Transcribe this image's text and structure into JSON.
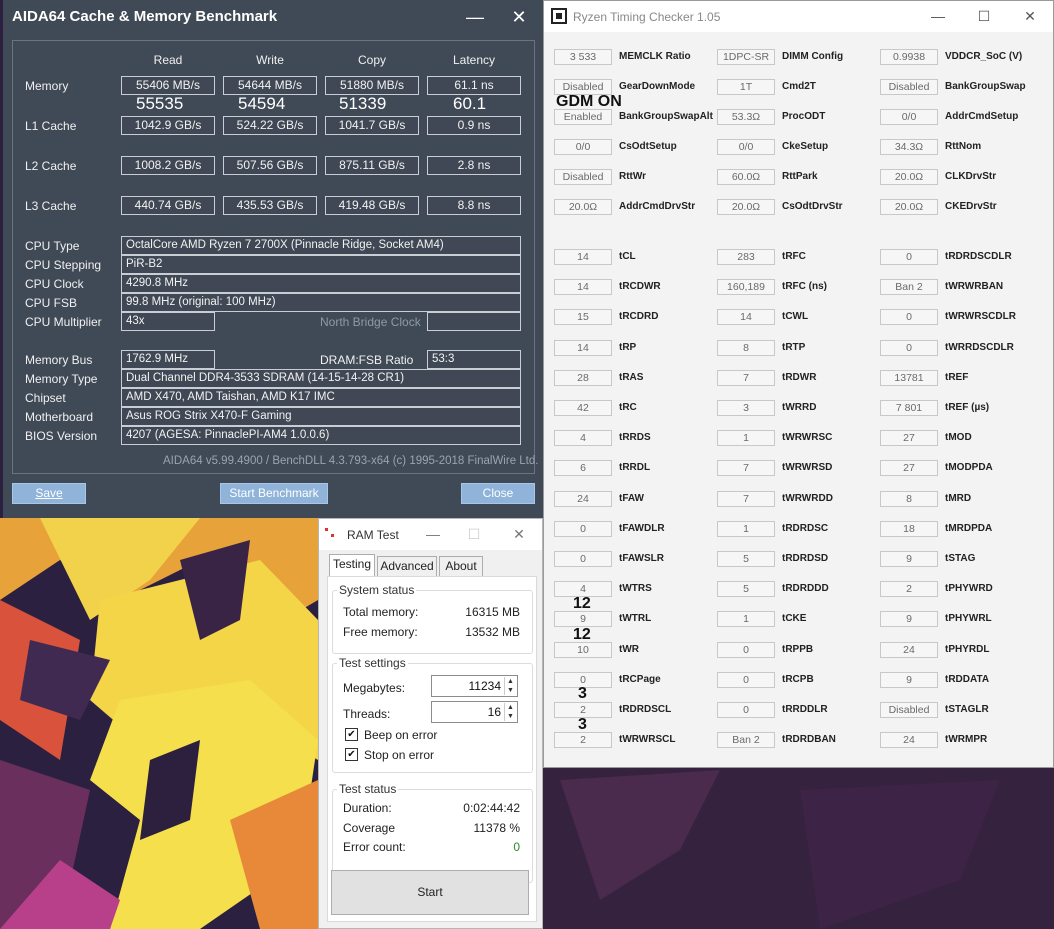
{
  "aida": {
    "title": "AIDA64 Cache & Memory Benchmark",
    "minimize": "—",
    "close": "✕",
    "columns": [
      "Read",
      "Write",
      "Copy",
      "Latency"
    ],
    "memory_label": "Memory",
    "memory": [
      "55406 MB/s",
      "54644 MB/s",
      "51880 MB/s",
      "61.1 ns"
    ],
    "memory_prev": [
      "55535",
      "54594",
      "51339",
      "60.1"
    ],
    "l1_label": "L1 Cache",
    "l1": [
      "1042.9 GB/s",
      "524.22 GB/s",
      "1041.7 GB/s",
      "0.9 ns"
    ],
    "l2_label": "L2 Cache",
    "l2": [
      "1008.2 GB/s",
      "507.56 GB/s",
      "875.11 GB/s",
      "2.8 ns"
    ],
    "l3_label": "L3 Cache",
    "l3": [
      "440.74 GB/s",
      "435.53 GB/s",
      "419.48 GB/s",
      "8.8 ns"
    ],
    "info": [
      {
        "label": "CPU Type",
        "value": "OctalCore AMD Ryzen 7 2700X  (Pinnacle Ridge, Socket AM4)"
      },
      {
        "label": "CPU Stepping",
        "value": "PiR-B2"
      },
      {
        "label": "CPU Clock",
        "value": "4290.8 MHz"
      },
      {
        "label": "CPU FSB",
        "value": "99.8 MHz  (original: 100 MHz)"
      },
      {
        "label": "CPU Multiplier",
        "value": "43x"
      }
    ],
    "nb_clock_label": "North Bridge Clock",
    "membus_label": "Memory Bus",
    "membus_value": "1762.9 MHz",
    "dramfsb_label": "DRAM:FSB Ratio",
    "dramfsb_value": "53:3",
    "info2": [
      {
        "label": "Memory Type",
        "value": "Dual Channel DDR4-3533 SDRAM  (14-15-14-28 CR1)"
      },
      {
        "label": "Chipset",
        "value": "AMD X470, AMD Taishan, AMD K17 IMC"
      },
      {
        "label": "Motherboard",
        "value": "Asus ROG Strix X470-F Gaming"
      },
      {
        "label": "BIOS Version",
        "value": "4207  (AGESA: PinnaclePI-AM4 1.0.0.6)"
      }
    ],
    "footer": "AIDA64 v5.99.4900 / BenchDLL 4.3.793-x64  (c) 1995-2018 FinalWire Ltd.",
    "save": "Save",
    "start": "Start Benchmark",
    "close_btn": "Close"
  },
  "rtc": {
    "title": "Ryzen Timing Checker 1.05",
    "minimize": "—",
    "maximize": "☐",
    "close": "✕",
    "col1": [
      {
        "v": "3 533",
        "l": "MEMCLK Ratio"
      },
      {
        "v": "Disabled",
        "l": "GearDownMode"
      },
      {
        "v": "Enabled",
        "l": "BankGroupSwapAlt"
      },
      {
        "v": "0/0",
        "l": "CsOdtSetup"
      },
      {
        "v": "Disabled",
        "l": "RttWr"
      },
      {
        "v": "20.0Ω",
        "l": "AddrCmdDrvStr"
      }
    ],
    "col2": [
      {
        "v": "1DPC-SR",
        "l": "DIMM Config"
      },
      {
        "v": "1T",
        "l": "Cmd2T"
      },
      {
        "v": "53.3Ω",
        "l": "ProcODT"
      },
      {
        "v": "0/0",
        "l": "CkeSetup"
      },
      {
        "v": "60.0Ω",
        "l": "RttPark"
      },
      {
        "v": "20.0Ω",
        "l": "CsOdtDrvStr"
      }
    ],
    "col3": [
      {
        "v": "0.9938",
        "l": "VDDCR_SoC (V)"
      },
      {
        "v": "Disabled",
        "l": "BankGroupSwap"
      },
      {
        "v": "0/0",
        "l": "AddrCmdSetup"
      },
      {
        "v": "34.3Ω",
        "l": "RttNom"
      },
      {
        "v": "20.0Ω",
        "l": "CLKDrvStr"
      },
      {
        "v": "20.0Ω",
        "l": "CKEDrvStr"
      }
    ],
    "t1": [
      {
        "v": "14",
        "l": "tCL"
      },
      {
        "v": "14",
        "l": "tRCDWR"
      },
      {
        "v": "15",
        "l": "tRCDRD"
      },
      {
        "v": "14",
        "l": "tRP"
      },
      {
        "v": "28",
        "l": "tRAS"
      },
      {
        "v": "42",
        "l": "tRC"
      },
      {
        "v": "4",
        "l": "tRRDS"
      },
      {
        "v": "6",
        "l": "tRRDL"
      },
      {
        "v": "24",
        "l": "tFAW"
      },
      {
        "v": "0",
        "l": "tFAWDLR"
      },
      {
        "v": "0",
        "l": "tFAWSLR"
      },
      {
        "v": "4",
        "l": "tWTRS"
      },
      {
        "v": "9",
        "l": "tWTRL"
      },
      {
        "v": "10",
        "l": "tWR"
      },
      {
        "v": "0",
        "l": "tRCPage"
      },
      {
        "v": "2",
        "l": "tRDRDSCL"
      },
      {
        "v": "2",
        "l": "tWRWRSCL"
      }
    ],
    "t2": [
      {
        "v": "283",
        "l": "tRFC"
      },
      {
        "v": "160,189",
        "l": "tRFC (ns)"
      },
      {
        "v": "14",
        "l": "tCWL"
      },
      {
        "v": "8",
        "l": "tRTP"
      },
      {
        "v": "7",
        "l": "tRDWR"
      },
      {
        "v": "3",
        "l": "tWRRD"
      },
      {
        "v": "1",
        "l": "tWRWRSC"
      },
      {
        "v": "7",
        "l": "tWRWRSD"
      },
      {
        "v": "7",
        "l": "tWRWRDD"
      },
      {
        "v": "1",
        "l": "tRDRDSC"
      },
      {
        "v": "5",
        "l": "tRDRDSD"
      },
      {
        "v": "5",
        "l": "tRDRDDD"
      },
      {
        "v": "1",
        "l": "tCKE"
      },
      {
        "v": "0",
        "l": "tRPPB"
      },
      {
        "v": "0",
        "l": "tRCPB"
      },
      {
        "v": "0",
        "l": "tRRDDLR"
      },
      {
        "v": "Ban 2",
        "l": "tRDRDBAN"
      }
    ],
    "t3": [
      {
        "v": "0",
        "l": "tRDRDSCDLR"
      },
      {
        "v": "Ban 2",
        "l": "tWRWRBAN"
      },
      {
        "v": "0",
        "l": "tWRWRSCDLR"
      },
      {
        "v": "0",
        "l": "tWRRDSCDLR"
      },
      {
        "v": "13781",
        "l": "tREF"
      },
      {
        "v": "7 801",
        "l": "tREF (µs)"
      },
      {
        "v": "27",
        "l": "tMOD"
      },
      {
        "v": "27",
        "l": "tMODPDA"
      },
      {
        "v": "8",
        "l": "tMRD"
      },
      {
        "v": "18",
        "l": "tMRDPDA"
      },
      {
        "v": "9",
        "l": "tSTAG"
      },
      {
        "v": "2",
        "l": "tPHYWRD"
      },
      {
        "v": "9",
        "l": "tPHYWRL"
      },
      {
        "v": "24",
        "l": "tPHYRDL"
      },
      {
        "v": "9",
        "l": "tRDDATA"
      },
      {
        "v": "Disabled",
        "l": "tSTAGLR"
      },
      {
        "v": "24",
        "l": "tWRMPR"
      }
    ],
    "anno_gdm": "GDM ON",
    "anno_12a": "12",
    "anno_12b": "12",
    "anno_3a": "3",
    "anno_3b": "3"
  },
  "ram": {
    "title": "RAM Test",
    "minimize": "—",
    "maximize": "☐",
    "close": "✕",
    "tabs": [
      "Testing",
      "Advanced",
      "About"
    ],
    "system_status": "System status",
    "total_label": "Total memory:",
    "total_value": "16315 MB",
    "free_label": "Free memory:",
    "free_value": "13532 MB",
    "test_settings": "Test settings",
    "mb_label": "Megabytes:",
    "mb_value": "11234",
    "threads_label": "Threads:",
    "threads_value": "16",
    "beep_label": "Beep on error",
    "stop_label": "Stop on error",
    "check": "✔",
    "test_status": "Test status",
    "duration_label": "Duration:",
    "duration_value": "0:02:44:42",
    "coverage_label": "Coverage",
    "coverage_value": "11378 %",
    "errors_label": "Error count:",
    "errors_value": "0",
    "start": "Start"
  }
}
